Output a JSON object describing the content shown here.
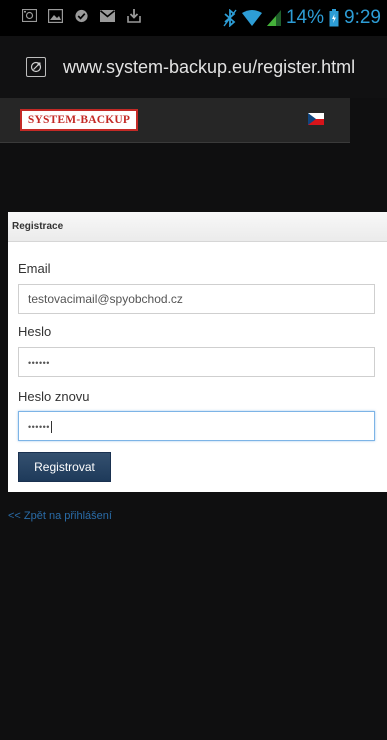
{
  "status_bar": {
    "left_icons": [
      "screenshot-icon",
      "gallery-icon",
      "check-cloud-icon",
      "gmail-icon",
      "download-icon"
    ],
    "right_icons": [
      "bluetooth-icon",
      "wifi-icon",
      "signal-icon",
      "battery-icon"
    ],
    "battery_percent": "14%",
    "time": "9:29",
    "accent_color": "#2d9dd6"
  },
  "browser": {
    "url": "www.system-backup.eu/register.html"
  },
  "site_header": {
    "logo_text": "SYSTEM-BACKUP",
    "logo_color": "#c42a26",
    "language_flag": "cz-flag-icon"
  },
  "form": {
    "heading": "Registrace",
    "email_label": "Email",
    "email_value": "testovacimail@spyobchod.cz",
    "password_label": "Heslo",
    "password_value": "••••••",
    "password_repeat_label": "Heslo znovu",
    "password_repeat_value": "••••••",
    "submit_label": "Registrovat",
    "button_color": "#1e3a5a"
  },
  "back_link": {
    "text": "<< Zpět na přihlášení",
    "color": "#2a6ca8"
  }
}
